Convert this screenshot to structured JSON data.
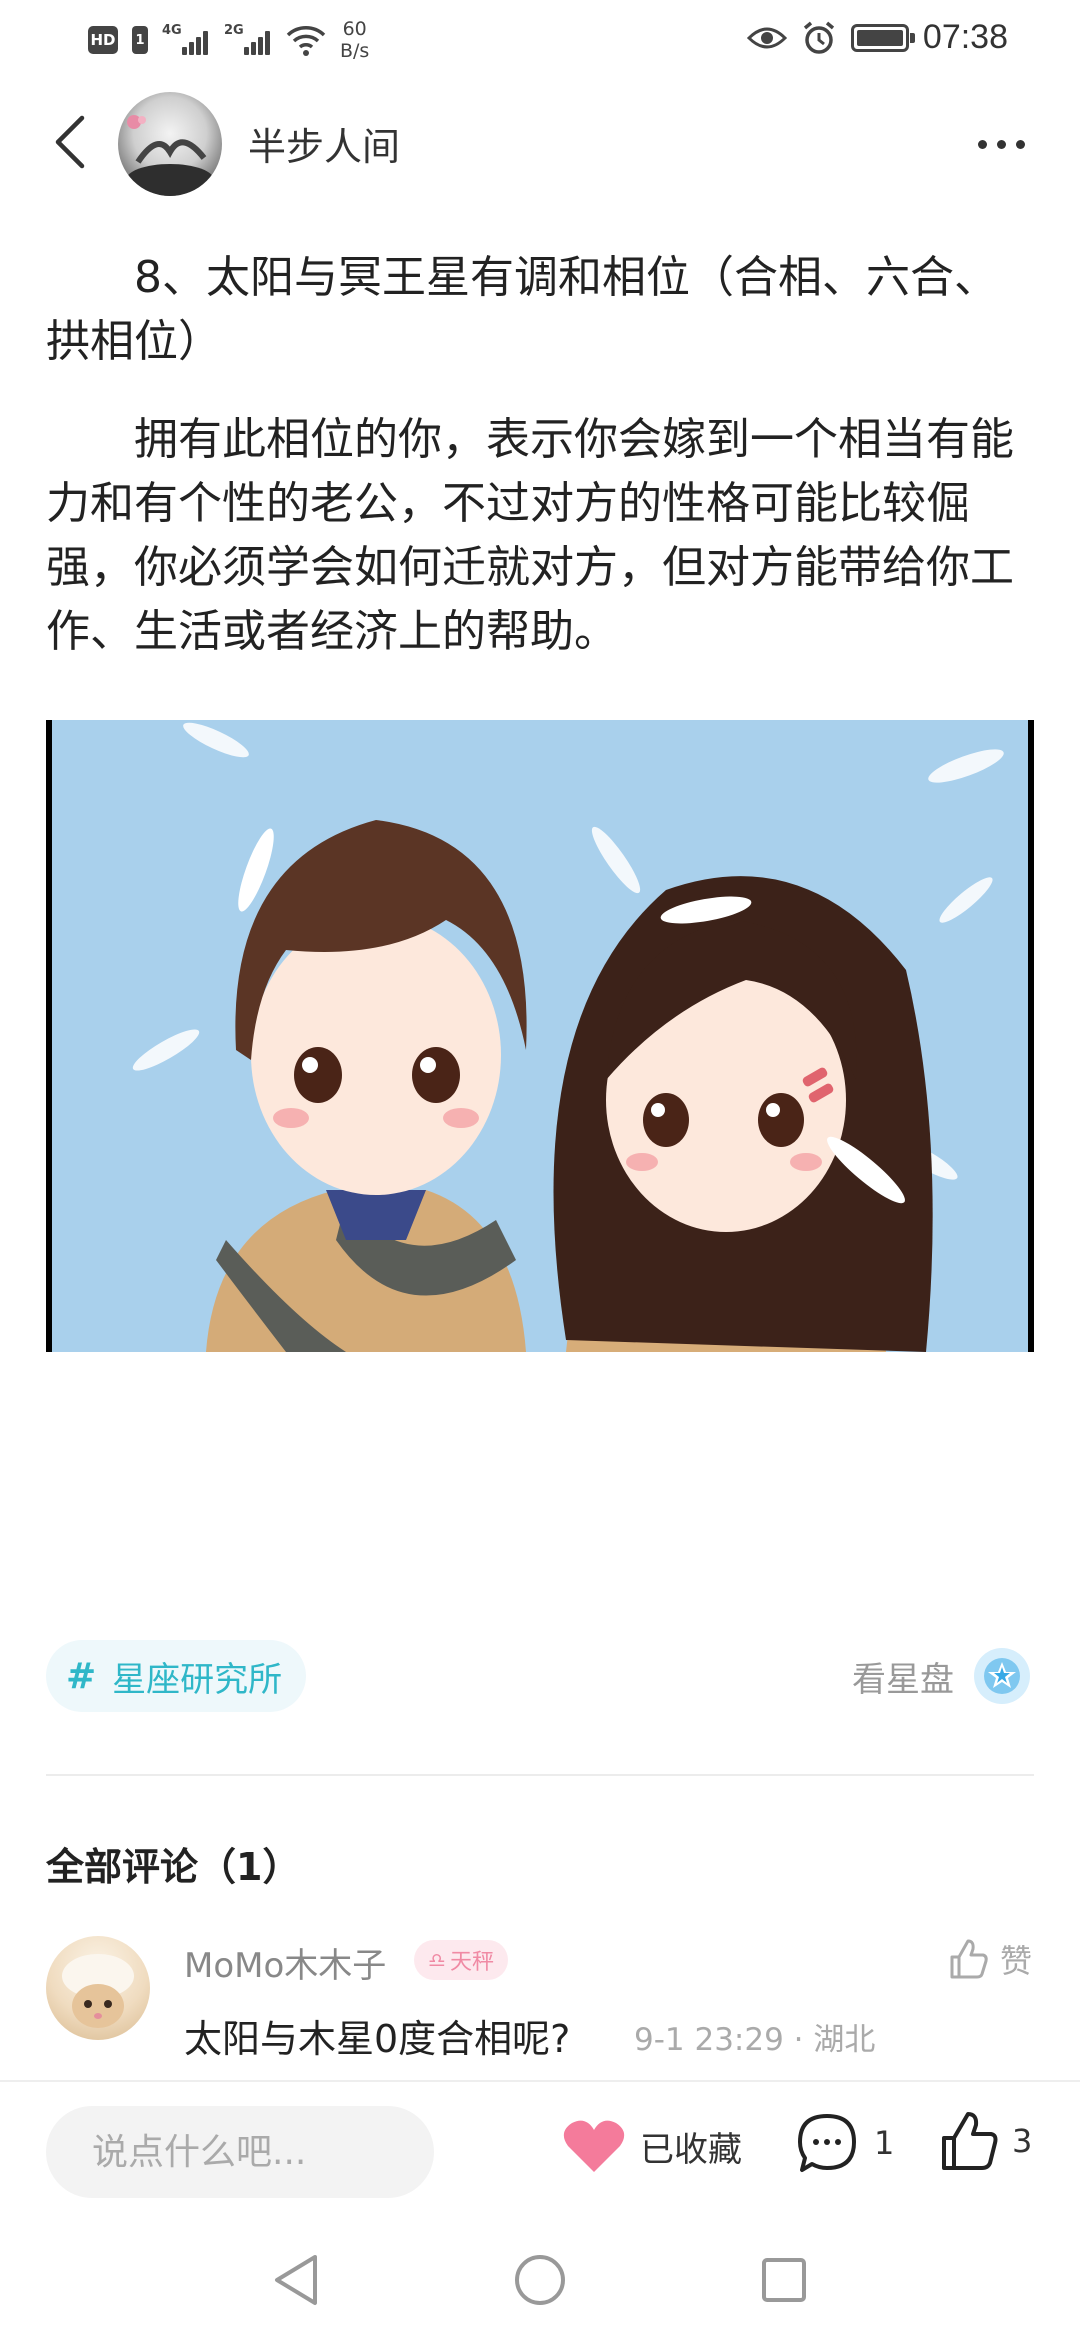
{
  "status_bar": {
    "hd": "HD",
    "sim": "1",
    "sig1_gen": "4G",
    "sig2_gen": "2G",
    "speed_value": "60",
    "speed_unit": "B/s",
    "time": "07:38",
    "icons": [
      "eye-icon",
      "alarm-icon",
      "battery-icon",
      "wifi-icon"
    ]
  },
  "header": {
    "author": "半步人间",
    "back_icon": "chevron-left-icon",
    "more_icon": "more-dots-icon"
  },
  "article": {
    "heading": "8、太阳与冥王星有调和相位（合相、六合、拱相位）",
    "body": "拥有此相位的你，表示你会嫁到一个相当有能力和有个性的老公，不过对方的性格可能比较倔强，你必须学会如何迁就对方，但对方能带给你工作、生活或者经济上的帮助。"
  },
  "topic": {
    "hash": "#",
    "name": "星座研究所"
  },
  "chart_link": {
    "label": "看星盘"
  },
  "comments": {
    "title": "全部评论（1）",
    "items": [
      {
        "user": "MoMo木木子",
        "zodiac_symbol": "♎",
        "zodiac": "天秤",
        "text": "太阳与木星0度合相呢?",
        "meta": "9-1 23:29 · 湖北",
        "like_label": "赞"
      }
    ]
  },
  "bottom_bar": {
    "input_placeholder": "说点什么吧...",
    "fav_label": "已收藏",
    "comment_count": "1",
    "like_count": "3"
  },
  "colors": {
    "accent": "#2fb7c8",
    "heart": "#f47b9b",
    "badge_bg": "#fde9ee",
    "sky": "#a9d0ec"
  }
}
